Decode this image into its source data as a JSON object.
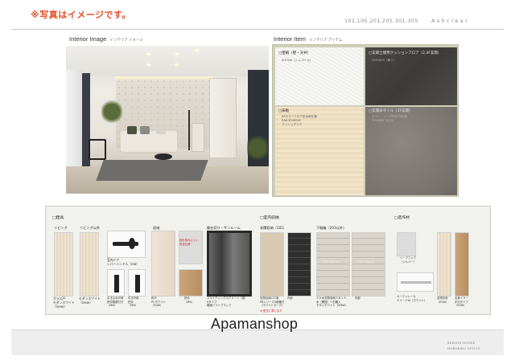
{
  "header": {
    "notice": "※写真はイメージです。",
    "property_code": "101.105.201.205.301.305",
    "brand": "Ashclear"
  },
  "interior_image": {
    "title": "Interior Image",
    "subtitle": "インテリア イメージ"
  },
  "interior_item": {
    "title": "Interior Item",
    "subtitle": "インテリア アイテム",
    "swatches": [
      {
        "label": "□壁紙（壁・天井）",
        "code": "SLP340（シンコール）"
      },
      {
        "label": "□玄関土間用クッションフロア（2,3F玄関）",
        "code": "20F1803（東リ）"
      },
      {
        "label": "□床板",
        "code": "AFカラーフロア防水用仕様\nSAK-3040SAC\nアッシュグリア"
      },
      {
        "label": "□玄関床タイル（1F玄関）",
        "code": "カラー：ナーヴ外外 300角\nZS-0663 70 15"
      }
    ]
  },
  "equipment": {
    "categories": {
      "fittings": "□建具",
      "storage": "□室内収納",
      "decor": "□造作材"
    },
    "subs": {
      "living": "リビング",
      "living_western": "リビング以外",
      "storage": "収納",
      "partition": "間仕切り・サンルーム",
      "entrance_storage": "玄関収納（101）",
      "shoe_storage": "下駄箱（201以外）"
    },
    "captions": {
      "door1": "ガラス戸\nモダンホワイト\n（SMW）",
      "door2": "モダンホワイト\n（SMW）",
      "handle": "室内ドア\nレバーハンドル（MB）",
      "pull1": "引き込み戸用\n把手取替付き\n（MB）",
      "pull2": "引き戸用\n把手\n（MB）",
      "closet1": "折戸\nPCホワイト\n（ESW）",
      "closet_note": "指を挟みにくい\n安全仕様",
      "closet2": "把手\n（MB）",
      "slide": "スライディングスクリーン（型）\nSタイプ\n樹脂ソフトブラック",
      "entrance": "玄関収納CTC案\nPRシリーズ4段棚付\n（ホワイトオーク）",
      "inside": "内部",
      "shoe_main": "ＳＨ木玄関収納ＳＢ１５\n木（開閉）＋石鹸入\nモダンホワイト（SMW）",
      "inside2": "内部",
      "curtain_hook": "リーフフック\n（シルバー）",
      "curtain_rail": "カーテンレール\nエリートＷ（ホワイト）",
      "mirror_door": "玄関手前\n（ESW）",
      "full_mirror": "全身ミラー\n手付タイプ\n（ESW）",
      "note": "※ 型式に準じます"
    },
    "shoe_door_label1": "ミラーＨａ-ト",
    "shoe_door_label2": "ミラーＨａ-ト"
  },
  "watermark": "Apamanshop",
  "footer": {
    "line1": "SEKISUI HOUSE",
    "line2": "HOKURIKU OFFICE"
  }
}
